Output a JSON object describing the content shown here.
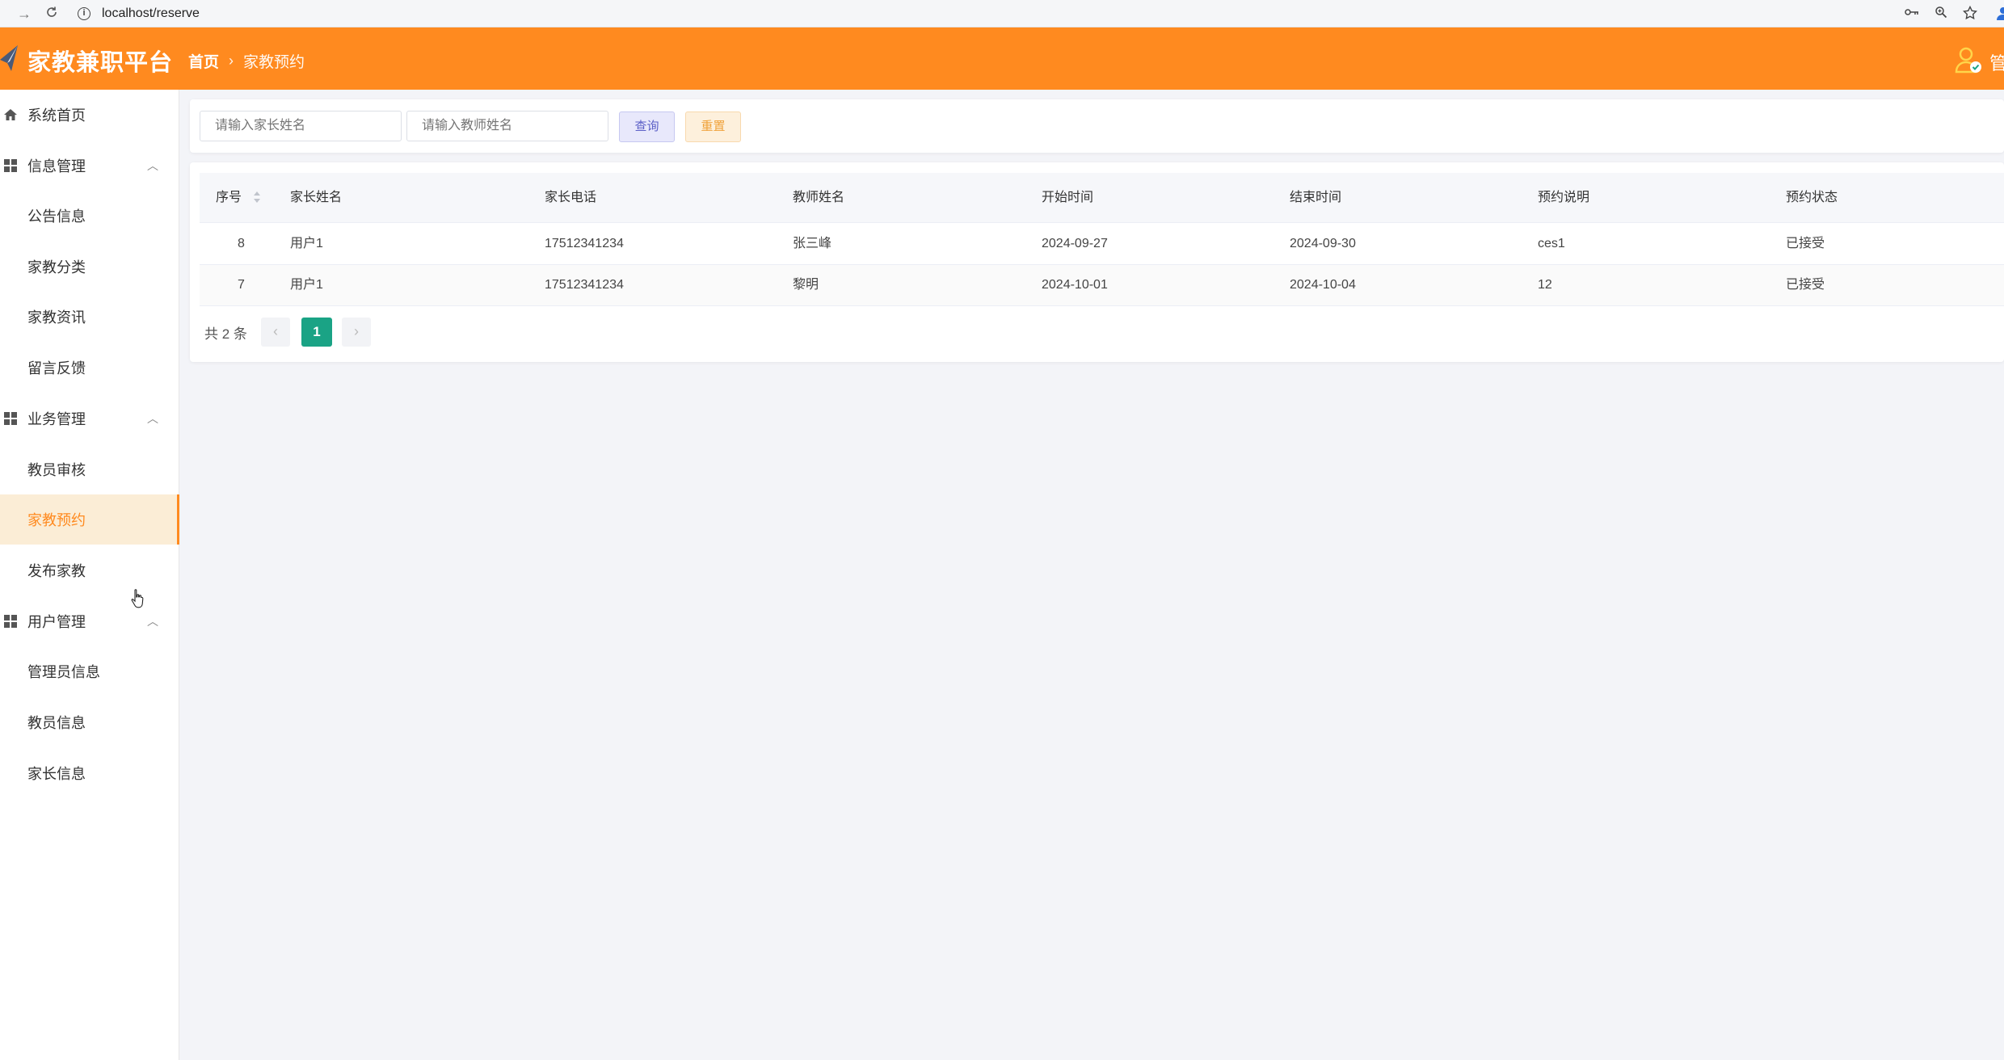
{
  "browser": {
    "url": "localhost/reserve",
    "back_icon": "back-arrow-icon",
    "reload_icon": "reload-icon",
    "right_icons": [
      "password-key-icon",
      "zoom-icon",
      "bookmark-star-icon",
      "profile-icon"
    ]
  },
  "header": {
    "logo_text": "家教兼职平台",
    "breadcrumb_home": "首页",
    "breadcrumb_sep": "›",
    "breadcrumb_current": "家教预约",
    "user_name": "管",
    "brand_color": "#ff8a1f"
  },
  "sidebar": {
    "home": "系统首页",
    "groups": [
      {
        "label": "信息管理",
        "items": [
          "公告信息",
          "家教分类",
          "家教资讯",
          "留言反馈"
        ]
      },
      {
        "label": "业务管理",
        "items": [
          "教员审核",
          "家教预约",
          "发布家教"
        ]
      },
      {
        "label": "用户管理",
        "items": [
          "管理员信息",
          "教员信息",
          "家长信息"
        ]
      }
    ],
    "active_item": "家教预约"
  },
  "search": {
    "parent_placeholder": "请输入家长姓名",
    "teacher_placeholder": "请输入教师姓名",
    "query_label": "查询",
    "reset_label": "重置"
  },
  "table": {
    "columns": [
      "序号",
      "家长姓名",
      "家长电话",
      "教师姓名",
      "开始时间",
      "结束时间",
      "预约说明",
      "预约状态"
    ],
    "rows": [
      [
        "8",
        "用户1",
        "17512341234",
        "张三峰",
        "2024-09-27",
        "2024-09-30",
        "ces1",
        "已接受"
      ],
      [
        "7",
        "用户1",
        "17512341234",
        "黎明",
        "2024-10-01",
        "2024-10-04",
        "12",
        "已接受"
      ]
    ]
  },
  "pagination": {
    "total": "共 2 条",
    "current_page": "1",
    "prev": "‹",
    "next": "›",
    "accent_color": "#1aa385"
  }
}
